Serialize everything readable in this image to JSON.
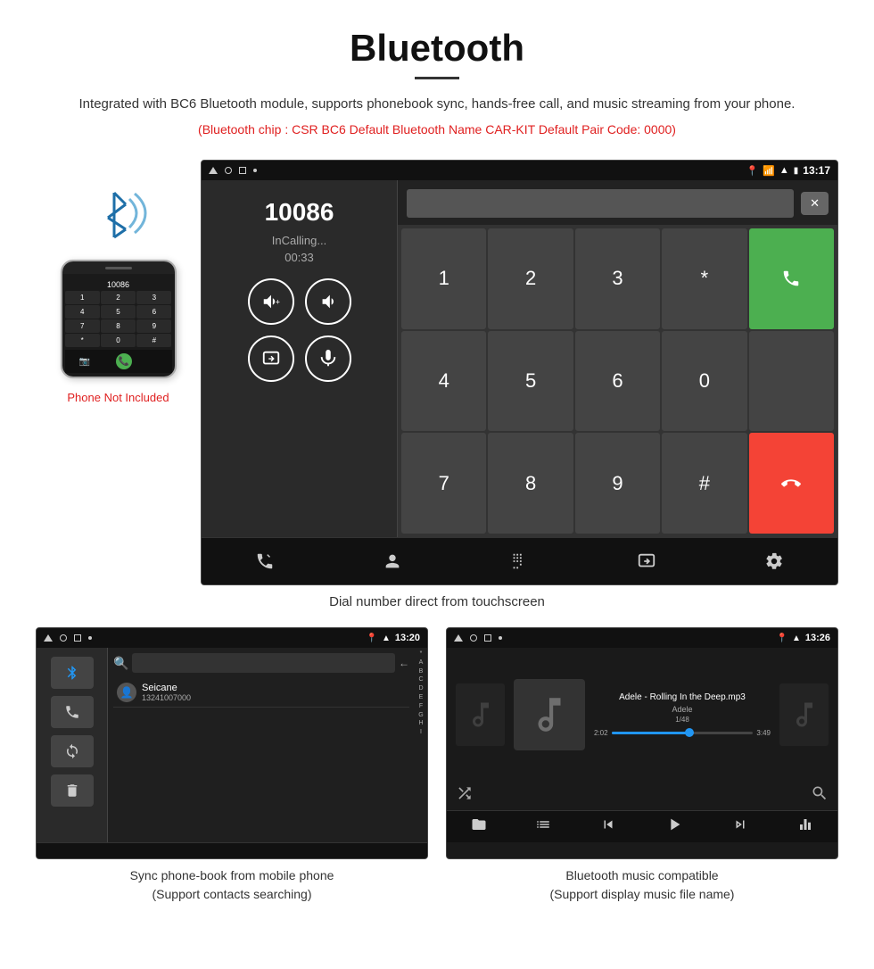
{
  "page": {
    "title": "Bluetooth",
    "description": "Integrated with BC6 Bluetooth module, supports phonebook sync, hands-free call, and music streaming from your phone.",
    "specs": "(Bluetooth chip : CSR BC6    Default Bluetooth Name CAR-KIT    Default Pair Code: 0000)",
    "phone_note": "Phone Not Included",
    "main_caption": "Dial number direct from touchscreen",
    "bottom_left_caption_line1": "Sync phone-book from mobile phone",
    "bottom_left_caption_line2": "(Support contacts searching)",
    "bottom_right_caption_line1": "Bluetooth music compatible",
    "bottom_right_caption_line2": "(Support display music file name)"
  },
  "call_screen": {
    "number": "10086",
    "status": "InCalling...",
    "timer": "00:33",
    "time": "13:17",
    "keypad": [
      "1",
      "2",
      "3",
      "*",
      "4",
      "5",
      "6",
      "0",
      "7",
      "8",
      "9",
      "#"
    ]
  },
  "phonebook_screen": {
    "time": "13:20",
    "contact_name": "Seicane",
    "contact_number": "13241007000",
    "alphabet": [
      "*",
      "A",
      "B",
      "C",
      "D",
      "E",
      "F",
      "G",
      "H",
      "I"
    ]
  },
  "music_screen": {
    "time": "13:26",
    "track": "Adele - Rolling In the Deep.mp3",
    "artist": "Adele",
    "track_num": "1/48",
    "time_current": "2:02",
    "time_total": "3:49"
  },
  "colors": {
    "green": "#4caf50",
    "red": "#f44336",
    "blue": "#2196f3",
    "pink": "#e02020",
    "dark_bg": "#1a1a1a"
  }
}
